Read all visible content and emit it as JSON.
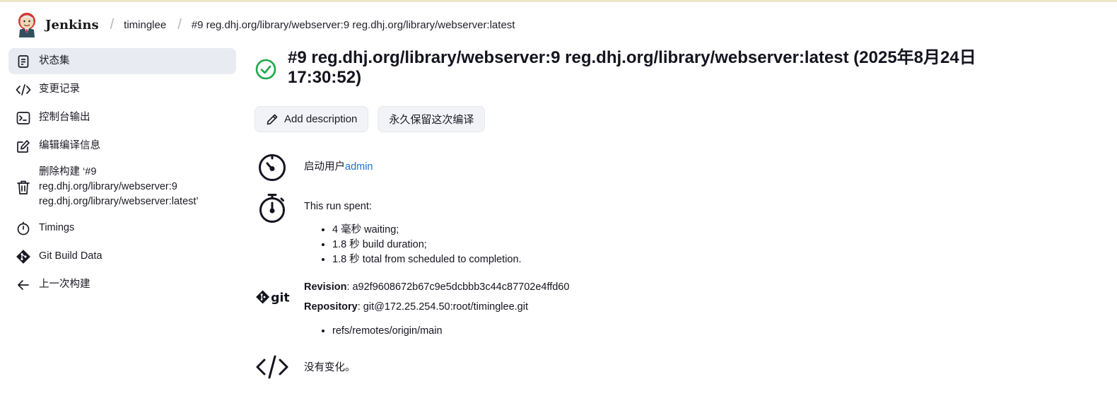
{
  "header": {
    "brand": "Jenkins",
    "breadcrumbs": [
      "timinglee",
      "#9 reg.dhj.org/library/webserver:9 reg.dhj.org/library/webserver:latest"
    ]
  },
  "sidebar": {
    "items": [
      {
        "label": "状态集",
        "icon": "document-icon",
        "active": true
      },
      {
        "label": "变更记录",
        "icon": "code-icon"
      },
      {
        "label": "控制台输出",
        "icon": "terminal-icon"
      },
      {
        "label": "编辑编译信息",
        "icon": "edit-icon"
      },
      {
        "label": "删除构建 ‘#9 reg.dhj.org/library/webserver:9 reg.dhj.org/library/webserver:latest’",
        "icon": "trash-icon"
      },
      {
        "label": "Timings",
        "icon": "stopwatch-icon"
      },
      {
        "label": "Git Build Data",
        "icon": "git-icon"
      },
      {
        "label": "上一次构建",
        "icon": "arrow-left-icon"
      }
    ]
  },
  "main": {
    "title": "#9 reg.dhj.org/library/webserver:9 reg.dhj.org/library/webserver:latest (2025年8月24日 17:30:52)",
    "status_icon": "success-check-icon",
    "buttons": {
      "add_description": "Add description",
      "keep_forever": "永久保留这次编译"
    },
    "started_by": {
      "prefix": "启动用户",
      "user": "admin"
    },
    "timings": {
      "heading": "This run spent:",
      "items": [
        "4 毫秒 waiting;",
        "1.8 秒 build duration;",
        "1.8 秒 total from scheduled to completion."
      ]
    },
    "git": {
      "icon_label": "git",
      "revision_label": "Revision",
      "revision": ": a92f9608672b67c9e5dcbbb3c44c87702e4ffd60",
      "repository_label": "Repository",
      "repository": ": git@172.25.254.50:root/timinglee.git",
      "refs": [
        "refs/remotes/origin/main"
      ]
    },
    "changes": "没有变化。"
  },
  "colors": {
    "success": "#1ea64a",
    "link": "#1f6fd1",
    "active_bg": "#e8ebf1"
  }
}
